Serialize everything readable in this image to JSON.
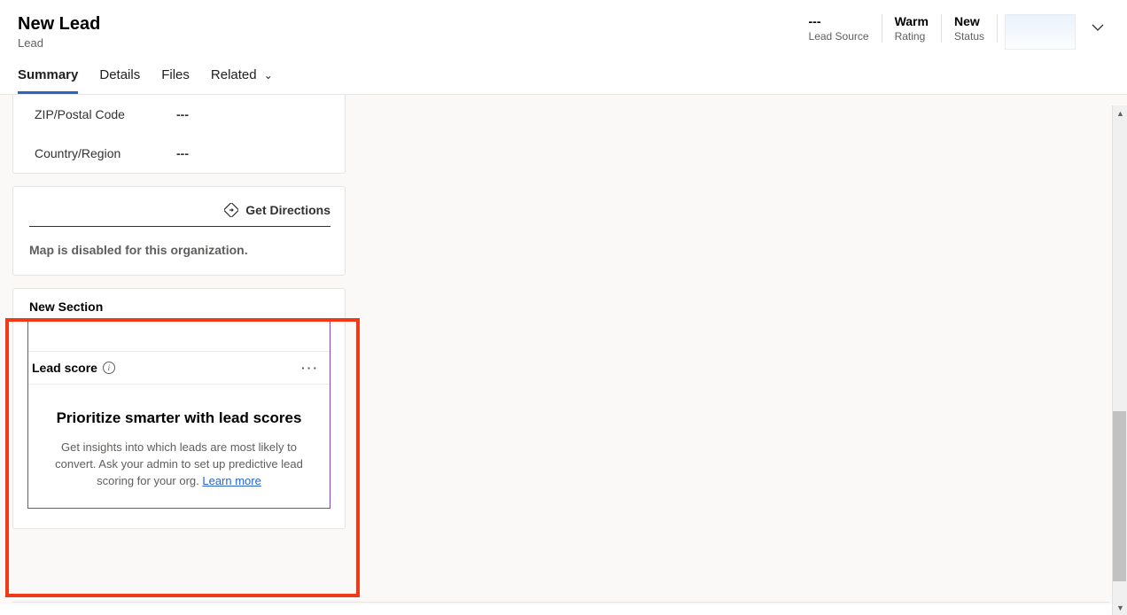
{
  "header": {
    "title": "New Lead",
    "subtitle": "Lead",
    "stats": [
      {
        "value": "---",
        "label": "Lead Source"
      },
      {
        "value": "Warm",
        "label": "Rating"
      },
      {
        "value": "New",
        "label": "Status"
      }
    ]
  },
  "tabs": {
    "summary": "Summary",
    "details": "Details",
    "files": "Files",
    "related": "Related"
  },
  "fields": {
    "zip": {
      "label": "ZIP/Postal Code",
      "value": "---"
    },
    "country": {
      "label": "Country/Region",
      "value": "---"
    }
  },
  "directions": {
    "link": "Get Directions",
    "disabled_msg": "Map is disabled for this organization."
  },
  "new_section": {
    "title": "New Section",
    "lead_score_label": "Lead score",
    "promo_title": "Prioritize smarter with lead scores",
    "promo_text": "Get insights into which leads are most likely to convert. Ask your admin to set up predictive lead scoring for your org. ",
    "learn_more": "Learn more"
  }
}
